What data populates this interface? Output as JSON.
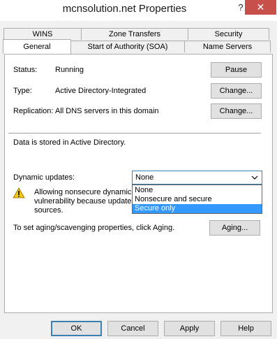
{
  "window": {
    "title": "mcnsolution.net Properties",
    "help_glyph": "?",
    "close_glyph": "✕"
  },
  "tabs": {
    "row1": [
      "WINS",
      "Zone Transfers",
      "Security"
    ],
    "row2": [
      "General",
      "Start of Authority (SOA)",
      "Name Servers"
    ],
    "active": "General"
  },
  "general": {
    "status_label": "Status:",
    "status_value": "Running",
    "pause_button": "Pause",
    "type_label": "Type:",
    "type_value": "Active Directory-Integrated",
    "type_change_button": "Change...",
    "replication_label": "Replication:",
    "replication_value": "All DNS servers in this domain",
    "replication_change_button": "Change...",
    "data_stored": "Data is stored in Active Directory.",
    "dynamic_updates_label": "Dynamic updates:",
    "dynamic_updates_value": "None",
    "dynamic_updates_options": [
      "None",
      "Nonsecure and secure",
      "Secure only"
    ],
    "dynamic_updates_highlighted": "Secure only",
    "warning_line1": "Allowing nonsecure dynamic u",
    "warning_line2": "vulnerability because updates",
    "warning_line3": "sources.",
    "aging_text": "To set aging/scavenging properties, click Aging.",
    "aging_button": "Aging..."
  },
  "footer": {
    "ok": "OK",
    "cancel": "Cancel",
    "apply": "Apply",
    "help": "Help"
  },
  "colors": {
    "close_button": "#c7504b",
    "selection": "#3399ff",
    "focus_border": "#3c7fb1",
    "warning": "#f2c511"
  }
}
